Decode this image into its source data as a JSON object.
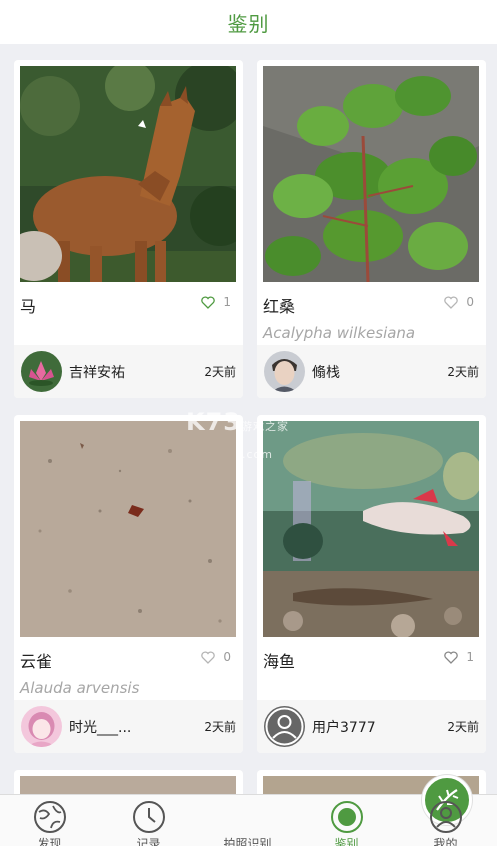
{
  "header": {
    "title": "鉴别"
  },
  "cards": [
    {
      "name": "马",
      "latin": "",
      "likes": "1",
      "user": "吉祥安祐",
      "time": "2天前",
      "liked": true
    },
    {
      "name": "红桑",
      "latin": "Acalypha wilkesiana",
      "likes": "0",
      "user": "翛栈",
      "time": "2天前",
      "liked": false
    },
    {
      "name": "云雀",
      "latin": "Alauda arvensis",
      "likes": "0",
      "user": "时光___...",
      "time": "2天前",
      "liked": false
    },
    {
      "name": "海鱼",
      "latin": "",
      "likes": "1",
      "user": "用户3777",
      "time": "2天前",
      "liked": false
    }
  ],
  "watermark": {
    "brand": "K73",
    "sub": "游戏之家",
    "domain": ".com"
  },
  "tabs": [
    {
      "label": "发现",
      "icon": "globe-leaf-icon"
    },
    {
      "label": "记录",
      "icon": "clock-icon"
    },
    {
      "label": "拍照识别",
      "icon": "camera-leaf-icon"
    },
    {
      "label": "鉴别",
      "icon": "target-icon",
      "active": true
    },
    {
      "label": "我的",
      "icon": "user-icon"
    }
  ],
  "colors": {
    "accent": "#4f9a41",
    "background": "#eeeff3",
    "card": "#ffffff"
  }
}
